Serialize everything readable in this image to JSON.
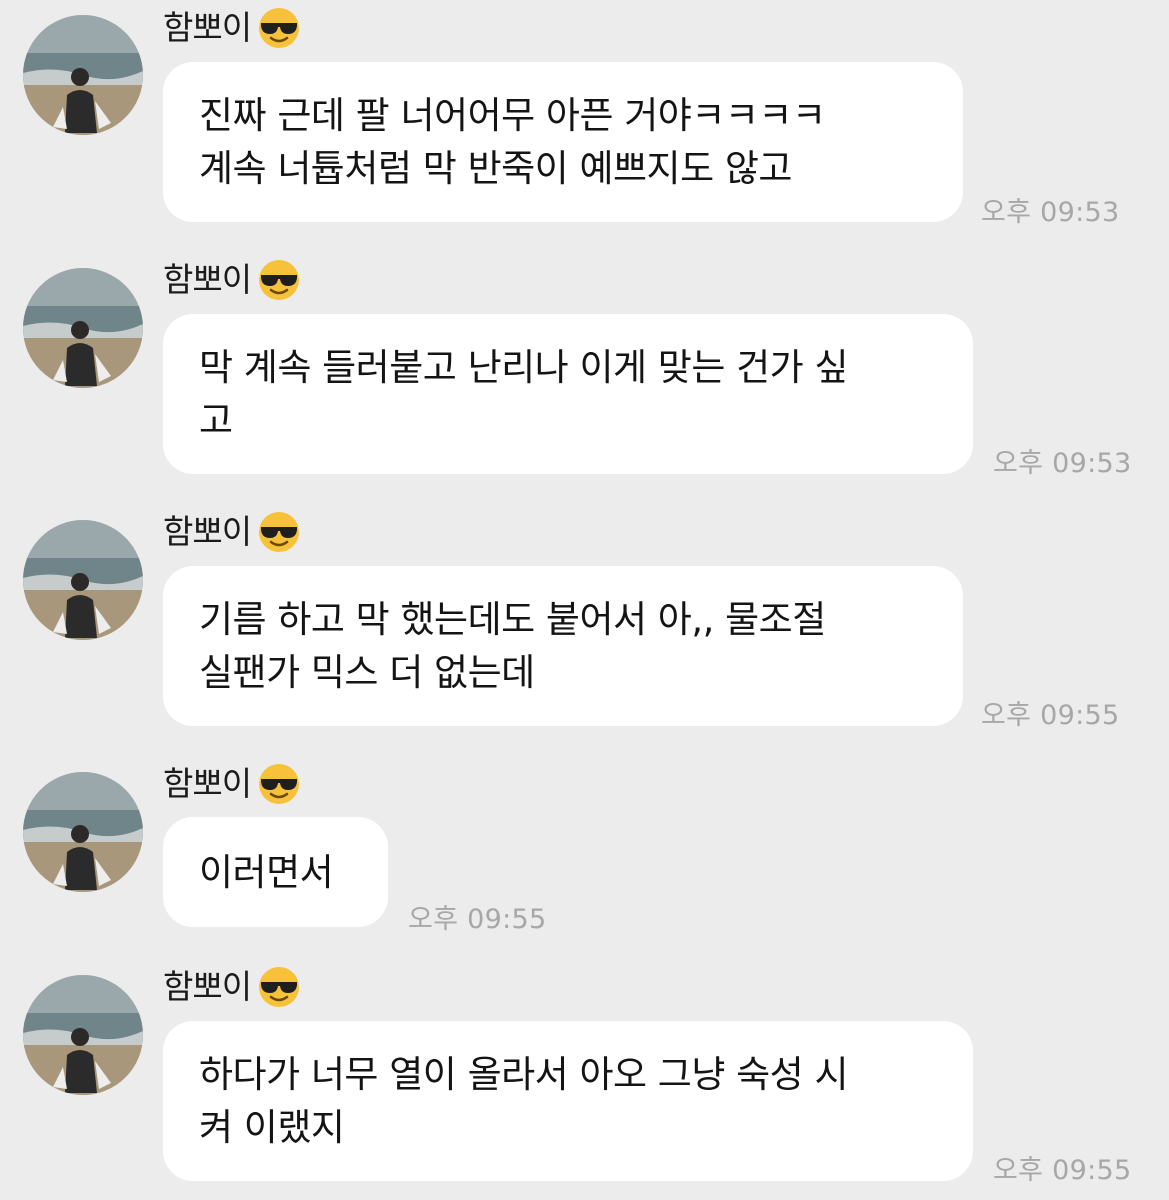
{
  "chat": {
    "messages": [
      {
        "sender": "함뽀이",
        "sender_emoji": "smiling-face-with-sunglasses-icon",
        "avatar": "beach-photo-avatar",
        "lines": [
          "진짜 근데 팔 너어어무 아픈 거야ㅋㅋㅋㅋ",
          "계속 너튭처럼 막 반죽이 예쁘지도 않고"
        ],
        "time": "오후 09:53"
      },
      {
        "sender": "함뽀이",
        "sender_emoji": "smiling-face-with-sunglasses-icon",
        "avatar": "beach-photo-avatar",
        "lines": [
          "막 계속 들러붙고 난리나 이게 맞는 건가 싶",
          "고"
        ],
        "time": "오후 09:53"
      },
      {
        "sender": "함뽀이",
        "sender_emoji": "smiling-face-with-sunglasses-icon",
        "avatar": "beach-photo-avatar",
        "lines": [
          "기름 하고 막 했는데도 붙어서 아,, 물조절",
          "실팬가 믹스 더 없는데"
        ],
        "time": "오후 09:55"
      },
      {
        "sender": "함뽀이",
        "sender_emoji": "smiling-face-with-sunglasses-icon",
        "avatar": "beach-photo-avatar",
        "lines": [
          "이러면서"
        ],
        "time": "오후 09:55"
      },
      {
        "sender": "함뽀이",
        "sender_emoji": "smiling-face-with-sunglasses-icon",
        "avatar": "beach-photo-avatar",
        "lines": [
          "하다가 너무 열이 올라서 아오 그냥 숙성 시",
          "켜 이랬지"
        ],
        "time": "오후 09:55"
      }
    ]
  },
  "colors": {
    "background": "#ececec",
    "bubble": "#ffffff",
    "text": "#141414",
    "timestamp": "#a7a7a7",
    "emoji_face": "#f7c23a"
  }
}
